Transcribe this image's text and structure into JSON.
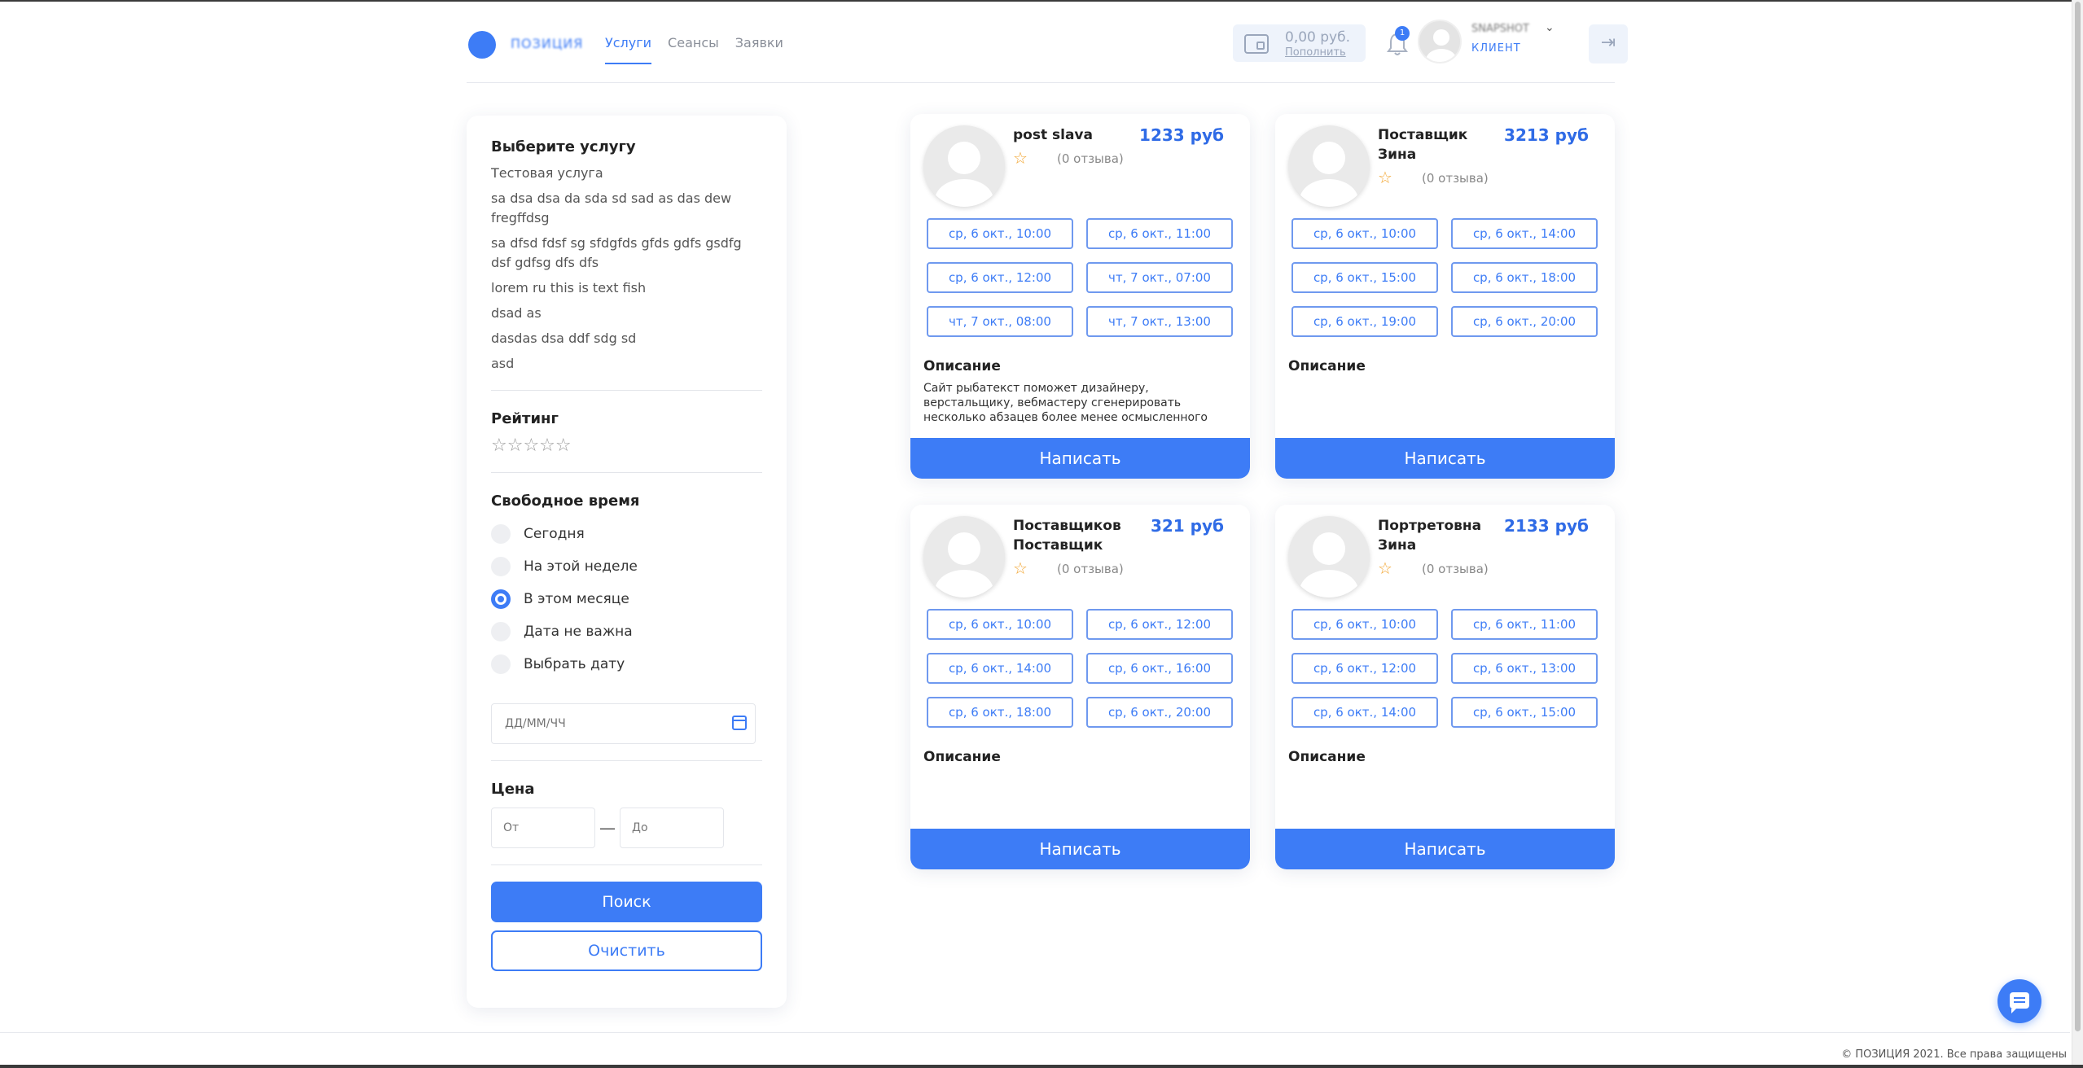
{
  "header": {
    "logo_text": "ПОЗИЦИЯ",
    "nav": [
      "Услуги",
      "Сеансы",
      "Заявки"
    ],
    "wallet_balance": "0,00 руб.",
    "wallet_topup": "Пополнить",
    "notifications_count": "1",
    "user_name": "SNAPSHOT",
    "user_role": "КЛИЕНТ"
  },
  "filters": {
    "service_title": "Выберите услугу",
    "services": [
      "Тестовая услуга",
      "sa dsa dsa da sda sd sad as das dew fregffdsg",
      "sa dfsd fdsf sg sfdgfds gfds gdfs gsdfg dsf gdfsg dfs dfs",
      "lorem ru this is text fish",
      "dsad as",
      "dasdas dsa ddf sdg sd",
      "asd"
    ],
    "rating_title": "Рейтинг",
    "rating_stars": "☆☆☆☆☆",
    "time_title": "Свободное время",
    "time_options": [
      "Сегодня",
      "На этой неделе",
      "В этом месяце",
      "Дата не важна",
      "Выбрать дату"
    ],
    "selected_time": "В этом месяце",
    "date_placeholder": "ДД/ММ/ЧЧ",
    "price_title": "Цена",
    "price_from_placeholder": "От",
    "price_to_placeholder": "До",
    "price_dash": "—",
    "search_label": "Поиск",
    "clear_label": "Очистить"
  },
  "cards": [
    {
      "name": "post slava",
      "price": "1233 руб",
      "star": "☆",
      "reviews": "(0 отзыва)",
      "slots": [
        "ср, 6 окт., 10:00",
        "ср, 6 окт., 11:00",
        "ср, 6 окт., 12:00",
        "чт, 7 окт., 07:00",
        "чт, 7 окт., 08:00",
        "чт, 7 окт., 13:00"
      ],
      "desc_title": "Описание",
      "desc": "Сайт рыбатекст поможет дизайнеру, верстальщику, вебмастеру сгенерировать несколько абзацев более менее осмысленного",
      "button": "Написать"
    },
    {
      "name": "Поставщик Зина",
      "price": "3213 руб",
      "star": "☆",
      "reviews": "(0 отзыва)",
      "slots": [
        "ср, 6 окт., 10:00",
        "ср, 6 окт., 14:00",
        "ср, 6 окт., 15:00",
        "ср, 6 окт., 18:00",
        "ср, 6 окт., 19:00",
        "ср, 6 окт., 20:00"
      ],
      "desc_title": "Описание",
      "desc": "",
      "button": "Написать"
    },
    {
      "name": "Поставщиков Поставщик",
      "price": "321 руб",
      "star": "☆",
      "reviews": "(0 отзыва)",
      "slots": [
        "ср, 6 окт., 10:00",
        "ср, 6 окт., 12:00",
        "ср, 6 окт., 14:00",
        "ср, 6 окт., 16:00",
        "ср, 6 окт., 18:00",
        "ср, 6 окт., 20:00"
      ],
      "desc_title": "Описание",
      "desc": "",
      "button": "Написать"
    },
    {
      "name": "Портретовна Зина",
      "price": "2133 руб",
      "star": "☆",
      "reviews": "(0 отзыва)",
      "slots": [
        "ср, 6 окт., 10:00",
        "ср, 6 окт., 11:00",
        "ср, 6 окт., 12:00",
        "ср, 6 окт., 13:00",
        "ср, 6 окт., 14:00",
        "ср, 6 окт., 15:00"
      ],
      "desc_title": "Описание",
      "desc": "",
      "button": "Написать"
    }
  ],
  "footer": {
    "copyright": "© ПОЗИЦИЯ 2021. Все права защищены"
  },
  "colors": {
    "accent": "#3d7cf6",
    "price": "#2f6be6",
    "star": "#f2a531"
  }
}
